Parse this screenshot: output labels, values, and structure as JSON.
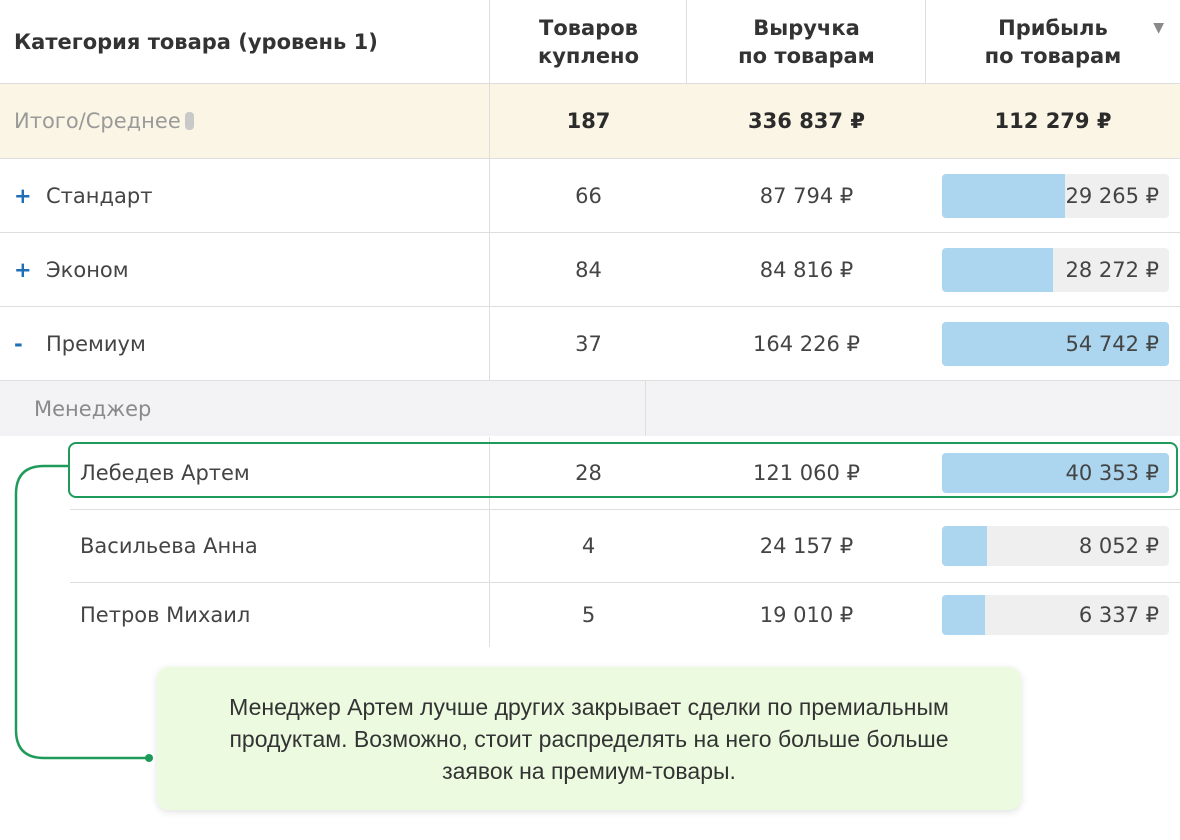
{
  "header": {
    "category": "Категория товара (уровень 1)",
    "qty_line1": "Товаров",
    "qty_line2": "куплено",
    "rev_line1": "Выручка",
    "rev_line2": "по товарам",
    "pro_line1": "Прибыль",
    "pro_line2": "по товарам",
    "sort_icon": "▼"
  },
  "total": {
    "label": "Итого/Среднее",
    "qty": "187",
    "revenue": "336 837 ₽",
    "profit": "112 279 ₽"
  },
  "categories": [
    {
      "toggle": "+",
      "name": "Стандарт",
      "qty": "66",
      "revenue": "87 794 ₽",
      "profit": "29 265 ₽",
      "profit_fraction": 0.54
    },
    {
      "toggle": "+",
      "name": "Эконом",
      "qty": "84",
      "revenue": "84 816 ₽",
      "profit": "28 272 ₽",
      "profit_fraction": 0.49
    },
    {
      "toggle": "-",
      "name": "Премиум",
      "qty": "37",
      "revenue": "164 226 ₽",
      "profit": "54 742 ₽",
      "profit_fraction": 1.0
    }
  ],
  "subgroup": {
    "label": "Менеджер",
    "rows": [
      {
        "name": "Лебедев Артем",
        "qty": "28",
        "revenue": "121 060 ₽",
        "profit": "40 353 ₽",
        "profit_fraction": 1.0
      },
      {
        "name": "Васильева Анна",
        "qty": "4",
        "revenue": "24 157 ₽",
        "profit": "8 052 ₽",
        "profit_fraction": 0.2
      },
      {
        "name": "Петров Михаил",
        "qty": "5",
        "revenue": "19 010 ₽",
        "profit": "6 337 ₽",
        "profit_fraction": 0.19
      }
    ]
  },
  "callout": {
    "text": "Менеджер Артем лучше других закрывает сделки по премиальным продуктам. Возможно, стоит распределять на него больше больше заявок на премиум-товары."
  },
  "colors": {
    "bar_fill": "#acd6f0",
    "bar_track": "#efefef",
    "highlight": "#1f9a5a",
    "total_bg": "#faf5e4",
    "callout_bg": "#ecfbe0"
  }
}
